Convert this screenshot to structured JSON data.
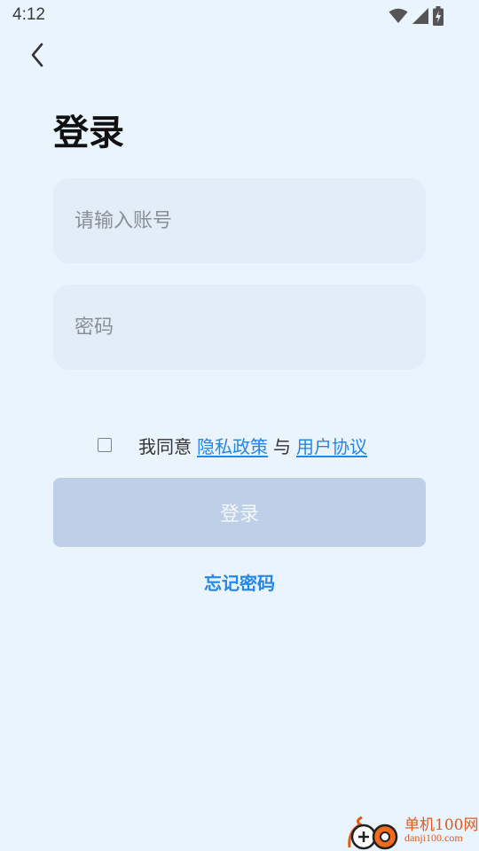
{
  "status_bar": {
    "time": "4:12",
    "icons": [
      "wifi-icon",
      "signal-icon",
      "battery-charging-icon"
    ]
  },
  "header": {
    "back_icon": "chevron-left-icon"
  },
  "title": "登录",
  "form": {
    "account_placeholder": "请输入账号",
    "password_placeholder": "密码"
  },
  "agreement": {
    "prefix": "我同意",
    "privacy_link": "隐私政策",
    "conjunction": "与",
    "terms_link": "用户协议",
    "checked": false
  },
  "login_button_label": "登录",
  "forgot_password_label": "忘记密码",
  "watermark": {
    "name": "单机100网",
    "url": "danji100.com"
  },
  "colors": {
    "background": "#eaf4fe",
    "field_background": "#e2edf8",
    "accent": "#2387e8",
    "button_disabled": "#bed0e7",
    "watermark": "#e05a1a"
  }
}
